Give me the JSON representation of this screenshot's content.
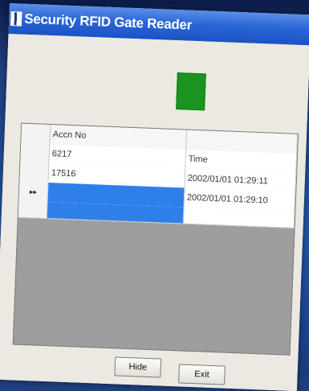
{
  "window": {
    "title": "Security RFID Gate Reader",
    "indicator_color": "#1a9320"
  },
  "grid": {
    "columns": [
      "Accn No",
      "Time"
    ],
    "rows": [
      {
        "accn_no": "6217",
        "time": "2002/01/01 01:29:11"
      },
      {
        "accn_no": "17516",
        "time": "2002/01/01 01:29:10"
      }
    ],
    "new_row_marker": "▸▸"
  },
  "buttons": {
    "hide_label": "Hide",
    "exit_label": "Exit"
  },
  "colors": {
    "titlebar": "#2b66d6",
    "selection": "#2f7fe8"
  }
}
